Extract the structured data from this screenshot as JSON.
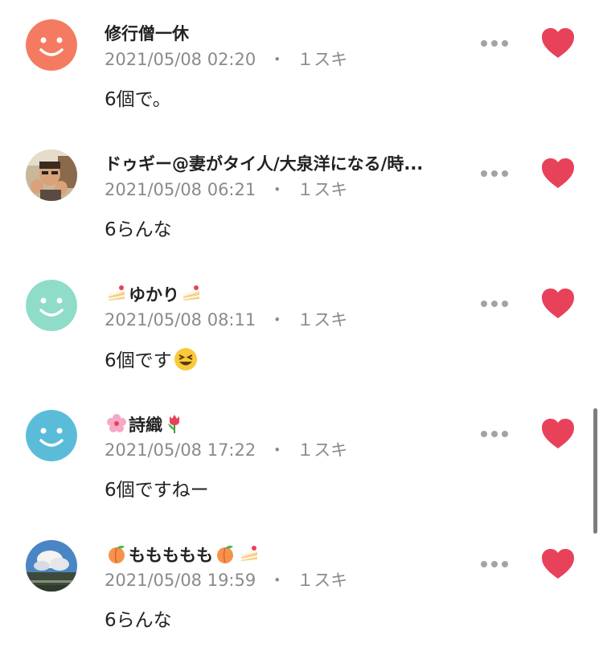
{
  "comments": [
    {
      "name": "修行僧一休",
      "time": "2021/05/08 02:20",
      "likes": "１スキ",
      "text": "6個で。",
      "avatar": "smiley-face-avatar",
      "avatar_color": "#f47a61"
    },
    {
      "name": "ドゥギー@妻がタイ人/大泉洋になる/時...",
      "time": "2021/05/08 06:21",
      "likes": "１スキ",
      "text": "6らんな",
      "avatar": "photo-avatar"
    },
    {
      "name": "ゆかり",
      "time": "2021/05/08 08:11",
      "likes": "１スキ",
      "text": "6個です",
      "avatar": "smiley-face-avatar",
      "avatar_color": "#8fdcc8"
    },
    {
      "name": "詩織",
      "time": "2021/05/08 17:22",
      "likes": "１スキ",
      "text": "6個ですねー",
      "avatar": "smiley-face-avatar",
      "avatar_color": "#5bbcd9"
    },
    {
      "name": "ももももも",
      "time": "2021/05/08 19:59",
      "likes": "１スキ",
      "text": "6らんな",
      "avatar": "photo-avatar-sky"
    }
  ],
  "separator": "・",
  "colors": {
    "heart": "#e8415a",
    "meta_text": "#8a8a8a",
    "more_dots": "#a3a3a3"
  },
  "icons": [
    "more-options-icon",
    "heart-icon",
    "cake-emoji-icon",
    "cherry-blossom-emoji-icon",
    "tulip-emoji-icon",
    "peach-emoji-icon",
    "grinning-squint-emoji-icon"
  ]
}
